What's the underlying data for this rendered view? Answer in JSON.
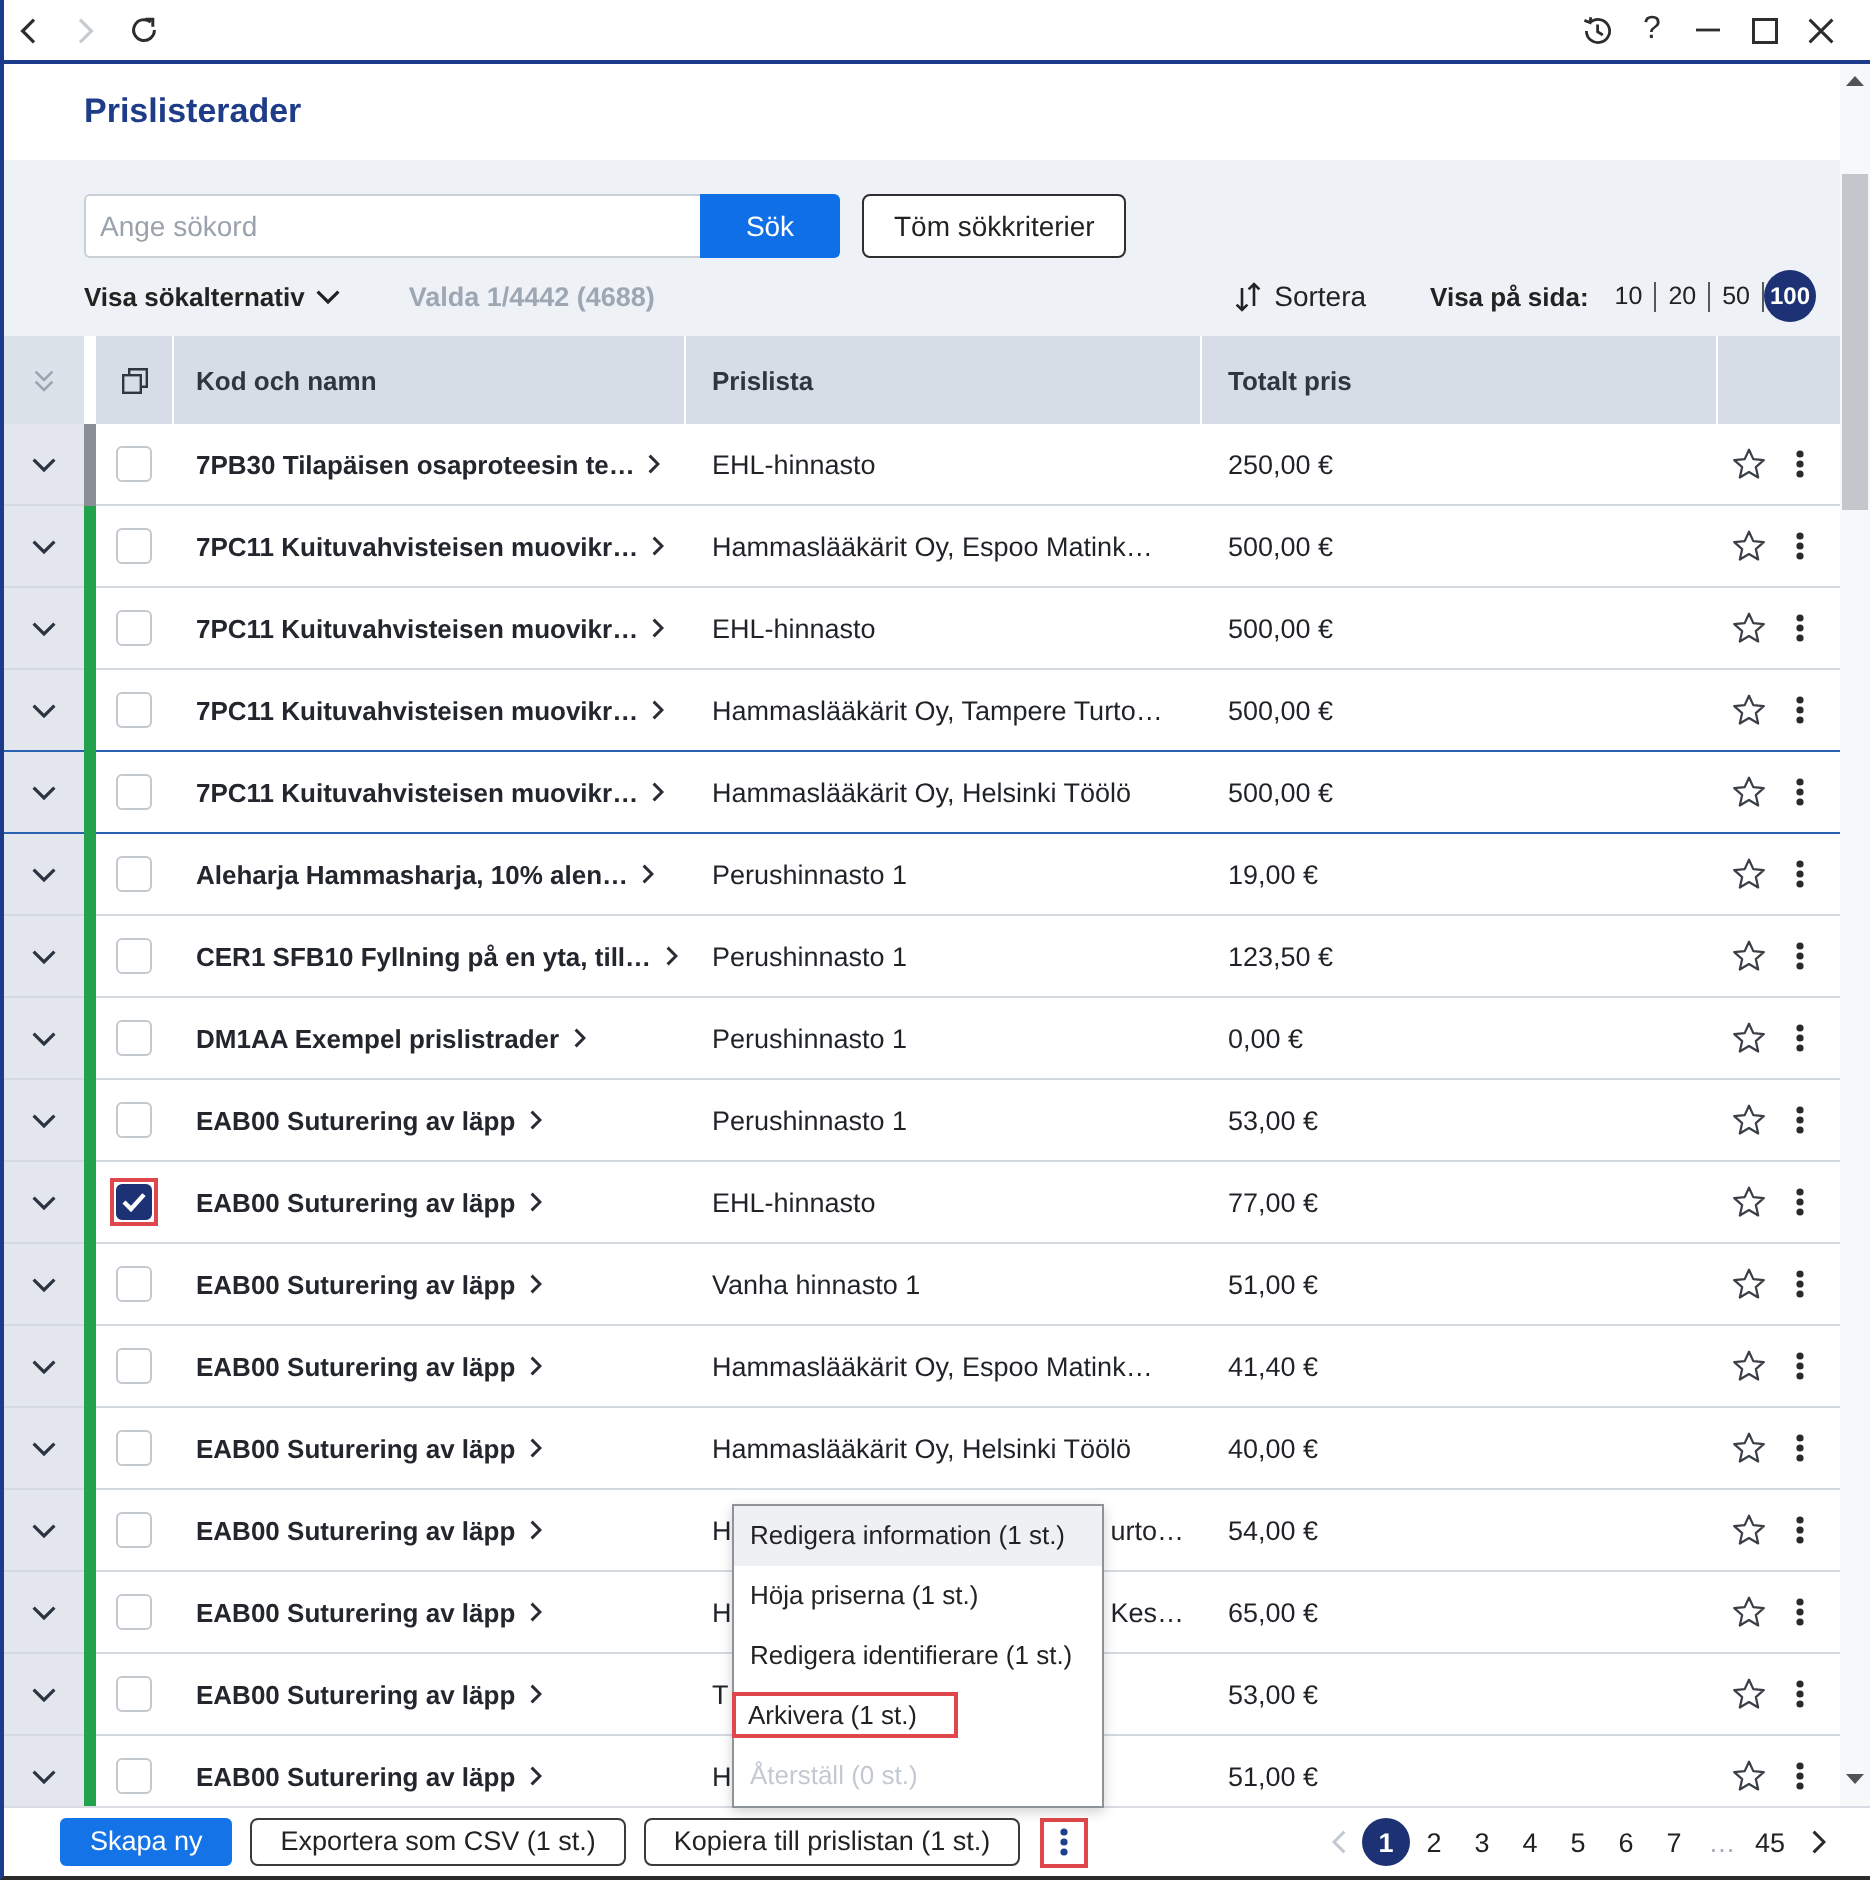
{
  "toolbar": {
    "nav": [
      {
        "kind": "back",
        "disabled": false
      },
      {
        "kind": "forward",
        "disabled": true
      },
      {
        "kind": "reload",
        "disabled": false
      }
    ],
    "controls": [
      {
        "kind": "history"
      },
      {
        "kind": "help",
        "label": "?"
      },
      {
        "kind": "minimize"
      },
      {
        "kind": "maximize"
      },
      {
        "kind": "close"
      }
    ]
  },
  "page": {
    "title": "Prislisterader"
  },
  "search": {
    "placeholder": "Ange sökord",
    "submit": "Sök",
    "clear": "Töm sökkriterier",
    "options_toggle": "Visa sökalternativ",
    "selection_info": "Valda 1/4442 (4688)",
    "sort": "Sortera",
    "page_size_label": "Visa på sida:",
    "page_sizes": [
      {
        "label": "10",
        "selected": false
      },
      {
        "label": "20",
        "selected": false
      },
      {
        "label": "50",
        "selected": false
      },
      {
        "label": "100",
        "selected": true
      }
    ]
  },
  "table": {
    "columns": [
      "Kod och namn",
      "Prislista",
      "Totalt pris"
    ],
    "rows": [
      {
        "color": "#8a8e96",
        "checked": false,
        "annotated": false,
        "focused": false,
        "starred": false,
        "name": "7PB30 Tilapäisen osaproteesin te…",
        "price_list": "EHL-hinnasto",
        "total": "250,00 €"
      },
      {
        "color": "#21a24b",
        "checked": false,
        "annotated": false,
        "focused": false,
        "starred": false,
        "name": "7PC11 Kuituvahvisteisen muovikr…",
        "price_list": "Hammaslääkärit Oy, Espoo Matink…",
        "total": "500,00 €"
      },
      {
        "color": "#21a24b",
        "checked": false,
        "annotated": false,
        "focused": false,
        "starred": false,
        "name": "7PC11 Kuituvahvisteisen muovikr…",
        "price_list": "EHL-hinnasto",
        "total": "500,00 €"
      },
      {
        "color": "#21a24b",
        "checked": false,
        "annotated": false,
        "focused": false,
        "starred": false,
        "name": "7PC11 Kuituvahvisteisen muovikr…",
        "price_list": "Hammaslääkärit Oy, Tampere Turto…",
        "total": "500,00 €"
      },
      {
        "color": "#21a24b",
        "checked": false,
        "annotated": false,
        "focused": true,
        "starred": false,
        "name": "7PC11 Kuituvahvisteisen muovikr…",
        "price_list": "Hammaslääkärit Oy, Helsinki Töölö",
        "total": "500,00 €"
      },
      {
        "color": "#21a24b",
        "checked": false,
        "annotated": false,
        "focused": false,
        "starred": false,
        "name": "Aleharja Hammasharja, 10% alen…",
        "price_list": "Perushinnasto 1",
        "total": "19,00 €"
      },
      {
        "color": "#21a24b",
        "checked": false,
        "annotated": false,
        "focused": false,
        "starred": false,
        "name": "CER1 SFB10 Fyllning på en yta, till…",
        "price_list": "Perushinnasto 1",
        "total": "123,50 €"
      },
      {
        "color": "#21a24b",
        "checked": false,
        "annotated": false,
        "focused": false,
        "starred": false,
        "name": "DM1AA Exempel prislistrader",
        "price_list": "Perushinnasto 1",
        "total": "0,00 €"
      },
      {
        "color": "#21a24b",
        "checked": false,
        "annotated": false,
        "focused": false,
        "starred": false,
        "name": "EAB00 Suturering av läpp",
        "price_list": "Perushinnasto 1",
        "total": "53,00 €"
      },
      {
        "color": "#21a24b",
        "checked": true,
        "annotated": true,
        "focused": false,
        "starred": false,
        "name": "EAB00 Suturering av läpp",
        "price_list": "EHL-hinnasto",
        "total": "77,00 €"
      },
      {
        "color": "#21a24b",
        "checked": false,
        "annotated": false,
        "focused": false,
        "starred": false,
        "name": "EAB00 Suturering av läpp",
        "price_list": "Vanha hinnasto 1",
        "total": "51,00 €"
      },
      {
        "color": "#21a24b",
        "checked": false,
        "annotated": false,
        "focused": false,
        "starred": false,
        "name": "EAB00 Suturering av läpp",
        "price_list": "Hammaslääkärit Oy, Espoo Matink…",
        "total": "41,40 €"
      },
      {
        "color": "#21a24b",
        "checked": false,
        "annotated": false,
        "focused": false,
        "starred": false,
        "name": "EAB00 Suturering av läpp",
        "price_list": "Hammaslääkärit Oy, Helsinki Töölö",
        "total": "40,00 €"
      },
      {
        "color": "#21a24b",
        "checked": false,
        "annotated": false,
        "focused": false,
        "starred": false,
        "name": "EAB00 Suturering av läpp",
        "price_list": "H",
        "price_list_end": "urto…",
        "total": "54,00 €"
      },
      {
        "color": "#21a24b",
        "checked": false,
        "annotated": false,
        "focused": false,
        "starred": false,
        "name": "EAB00 Suturering av läpp",
        "price_list": "H",
        "price_list_end": "Kes…",
        "total": "65,00 €"
      },
      {
        "color": "#21a24b",
        "checked": false,
        "annotated": false,
        "focused": false,
        "starred": false,
        "name": "EAB00 Suturering av läpp",
        "price_list": "T",
        "total": "53,00 €"
      },
      {
        "color": "#21a24b",
        "checked": false,
        "annotated": false,
        "focused": false,
        "starred": false,
        "name": "EAB00 Suturering av läpp",
        "price_list": "H",
        "total": "51,00 €"
      }
    ]
  },
  "footer": {
    "buttons": [
      {
        "kind": "primary",
        "label": "Skapa ny"
      },
      {
        "kind": "outline",
        "label": "Exportera som CSV (1 st.)"
      },
      {
        "kind": "outline",
        "label": "Kopiera till prislistan (1 st.)"
      }
    ],
    "more": {
      "annotated": true
    },
    "pagination": {
      "previous_disabled": true,
      "next_disabled": false,
      "pages": [
        {
          "kind": "page",
          "label": "1",
          "selected": true
        },
        {
          "kind": "page",
          "label": "2",
          "selected": false
        },
        {
          "kind": "page",
          "label": "3",
          "selected": false
        },
        {
          "kind": "page",
          "label": "4",
          "selected": false
        },
        {
          "kind": "page",
          "label": "5",
          "selected": false
        },
        {
          "kind": "page",
          "label": "6",
          "selected": false
        },
        {
          "kind": "page",
          "label": "7",
          "selected": false
        },
        {
          "kind": "gap",
          "label": "…"
        },
        {
          "kind": "page",
          "label": "45",
          "selected": false
        }
      ]
    }
  },
  "menu": {
    "items": [
      {
        "label": "Redigera information (1 st.)",
        "highlighted": true,
        "disabled": false,
        "annotated": false
      },
      {
        "label": "Höja priserna (1 st.)",
        "highlighted": false,
        "disabled": false,
        "annotated": false
      },
      {
        "label": "Redigera identifierare (1 st.)",
        "highlighted": false,
        "disabled": false,
        "annotated": false
      },
      {
        "label": "Arkivera (1 st.)",
        "highlighted": false,
        "disabled": false,
        "annotated": true
      },
      {
        "label": "Återställ (0 st.)",
        "highlighted": false,
        "disabled": true,
        "annotated": false
      }
    ]
  }
}
